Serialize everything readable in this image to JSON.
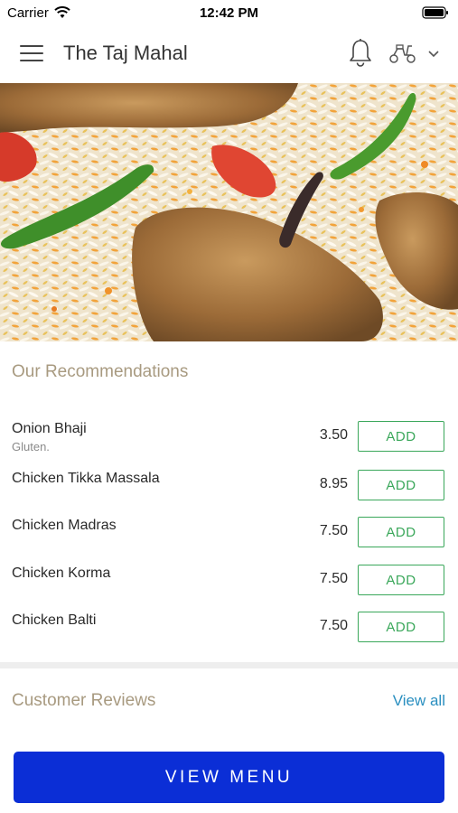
{
  "status_bar": {
    "carrier": "Carrier",
    "time": "12:42 PM",
    "icons": [
      "wifi-icon",
      "battery-icon"
    ]
  },
  "nav": {
    "title": "The Taj Mahal",
    "icons": [
      "menu-icon",
      "bell-icon",
      "scooter-icon",
      "chevron-down-icon"
    ]
  },
  "hero": {
    "image": "biryani-rice-with-chicken-and-chillies"
  },
  "recommendations": {
    "title": "Our Recommendations",
    "items": [
      {
        "name": "Onion Bhaji",
        "desc": "Gluten.",
        "price": "3.50",
        "add_label": "ADD"
      },
      {
        "name": "Chicken Tikka Massala",
        "desc": "",
        "price": "8.95",
        "add_label": "ADD"
      },
      {
        "name": "Chicken Madras",
        "desc": "",
        "price": "7.50",
        "add_label": "ADD"
      },
      {
        "name": "Chicken Korma",
        "desc": "",
        "price": "7.50",
        "add_label": "ADD"
      },
      {
        "name": "Chicken Balti",
        "desc": "",
        "price": "7.50",
        "add_label": "ADD"
      }
    ]
  },
  "reviews": {
    "title": "Customer Reviews",
    "view_all": "View all"
  },
  "cta": {
    "label": "VIEW MENU"
  },
  "colors": {
    "accent_green": "#3aa75a",
    "cta_blue": "#0b2ed6",
    "link_blue": "#2a8fc0",
    "section_title": "#a89a80"
  }
}
